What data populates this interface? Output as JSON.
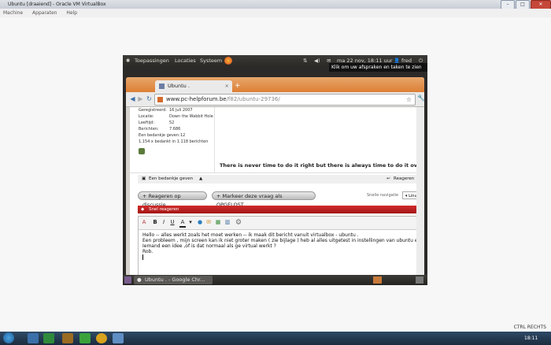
{
  "vbox": {
    "title": "Ubuntu [draaiend] - Oracle VM VirtualBox",
    "menu": [
      "Machine",
      "Apparaten",
      "Help"
    ],
    "status_label": "CTRL RECHTS"
  },
  "guest_panel": {
    "menus": [
      "Toepassingen",
      "Locaties",
      "Systeem"
    ],
    "datetime": "ma 22 nov, 18:11 uur",
    "user": "fred",
    "tooltip": "Klik om uw afspraken en taken te zien"
  },
  "browser": {
    "tab_title": "Ubuntu .",
    "url_domain": "www.pc-helpforum.be",
    "url_path": "/f82/ubuntu-29736/"
  },
  "post": {
    "details": [
      {
        "label": "Geregistreerd:",
        "value": "16 juli 2007"
      },
      {
        "label": "Locatie:",
        "value": "Down the Wabbit Hole"
      },
      {
        "label": "Leeftijd:",
        "value": "52"
      },
      {
        "label": "Berichten:",
        "value": "7.686"
      },
      {
        "label": "Een bedankje geven:",
        "value": "12"
      }
    ],
    "thanks_summary": "1.154 x bedankt in 1.118 berichten",
    "signature": "There is never time to do it right but there is always time to do it over.",
    "thanks_button": "Een bedankje geven",
    "reply_link": "Reageren"
  },
  "actions": {
    "reply_discussion": "+ Reageren op discussie",
    "mark_solved": "+ Markeer deze vraag als OPGELOST",
    "quick_nav_label": "Snelle navigatie",
    "quick_nav_value": "Linux"
  },
  "quick_reply": {
    "header": "Snel reageren",
    "lines": [
      "Hello -- alles werkt zoals het moet werken -- ik maak dit bericht vanuit virtualbox - ubuntu .",
      "Een probleem , mijn screen kan ik niet groter maken ( zie bijlage ) heb al alles uitgetest in instellingen van ubuntu en virtual box",
      "Iemand een idee ,of is dat normaal als ge virtual werkt ?",
      "Rob."
    ]
  },
  "guest_taskbar": {
    "window_title": "Ubuntu . - Google Chr..."
  },
  "win_taskbar": {
    "clock": "18:11"
  }
}
